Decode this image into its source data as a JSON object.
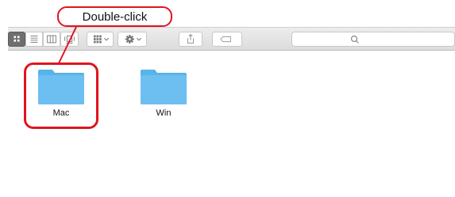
{
  "callout": {
    "text": "Double-click"
  },
  "toolbar": {
    "buttons": [
      {
        "icon": "icon-view-icon",
        "selected": true
      },
      {
        "icon": "list-view-icon",
        "selected": false
      },
      {
        "icon": "column-view-icon",
        "selected": false
      },
      {
        "icon": "cover-flow-view-icon",
        "selected": false
      },
      {
        "icon": "arrange-menu-icon",
        "selected": false
      },
      {
        "icon": "action-gear-icon",
        "selected": false
      },
      {
        "icon": "share-icon",
        "selected": false
      },
      {
        "icon": "tag-icon",
        "selected": false
      }
    ],
    "search": {
      "icon": "search-icon",
      "placeholder": ""
    }
  },
  "files": [
    {
      "name": "Mac",
      "type": "folder",
      "highlighted": true
    },
    {
      "name": "Win",
      "type": "folder",
      "highlighted": false
    }
  ],
  "colors": {
    "highlight": "#e0141e",
    "folder": "#6cbff0",
    "folder_tab": "#58b3e8",
    "toolbar_selected": "#6f6f6f"
  }
}
